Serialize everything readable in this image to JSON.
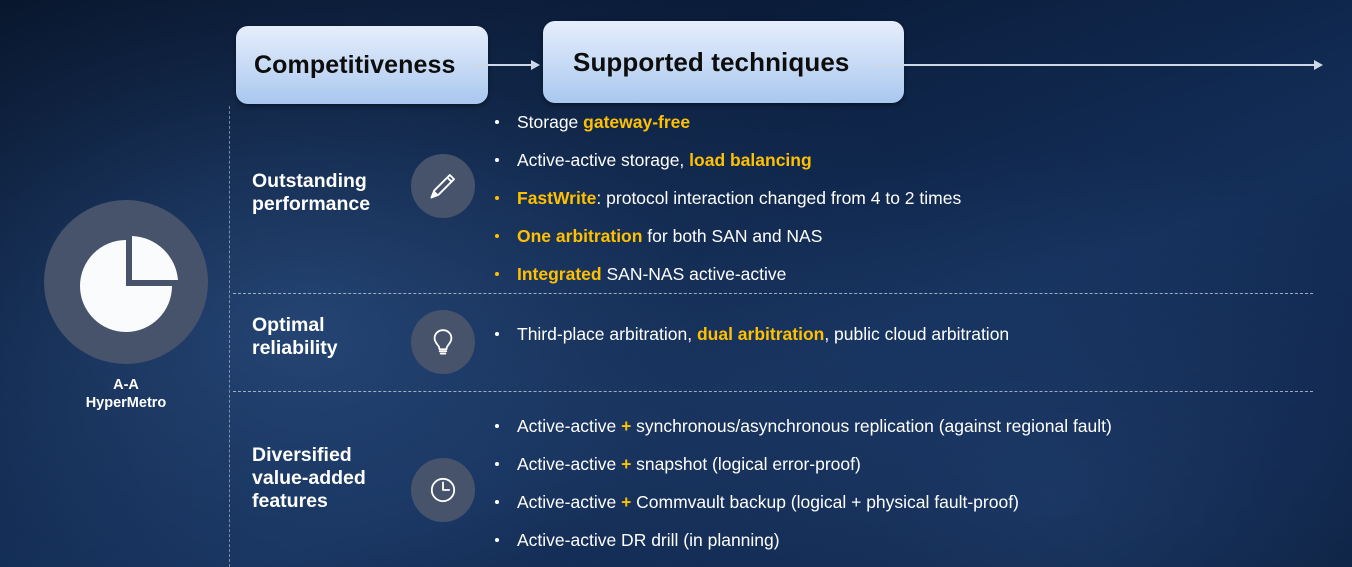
{
  "header": {
    "competitiveness_label": "Competitiveness",
    "supported_label": "Supported techniques"
  },
  "badge": {
    "icon": "pie-chart-icon",
    "line1": "A-A",
    "line2": "HyperMetro"
  },
  "colors": {
    "highlight": "#FFC000",
    "text": "#FFFFFF",
    "icon_circle": "#46536B",
    "header_box_text": "#0D0D0D"
  },
  "rows": [
    {
      "id": "performance",
      "label_line1": "Outstanding",
      "label_line2": "performance",
      "icon": "pencil-icon",
      "bullets": [
        {
          "dot": "white",
          "parts": [
            {
              "t": "Storage ",
              "hl": false
            },
            {
              "t": "gateway-free",
              "hl": true
            }
          ]
        },
        {
          "dot": "white",
          "parts": [
            {
              "t": "Active-active storage, ",
              "hl": false
            },
            {
              "t": "load balancing",
              "hl": true
            }
          ]
        },
        {
          "dot": "accent",
          "parts": [
            {
              "t": "FastWrite",
              "hl": true
            },
            {
              "t": ": protocol interaction changed from 4 to 2 times",
              "hl": false
            }
          ]
        },
        {
          "dot": "accent",
          "parts": [
            {
              "t": "One arbitration",
              "hl": true
            },
            {
              "t": " for both SAN and NAS",
              "hl": false
            }
          ]
        },
        {
          "dot": "accent",
          "parts": [
            {
              "t": "Integrated",
              "hl": true
            },
            {
              "t": " SAN-NAS active-active",
              "hl": false
            }
          ]
        }
      ]
    },
    {
      "id": "reliability",
      "label_line1": "Optimal",
      "label_line2": "reliability",
      "icon": "lightbulb-icon",
      "bullets": [
        {
          "dot": "white",
          "parts": [
            {
              "t": "Third-place arbitration, ",
              "hl": false
            },
            {
              "t": "dual arbitration",
              "hl": true
            },
            {
              "t": ", public cloud arbitration",
              "hl": false
            }
          ]
        }
      ]
    },
    {
      "id": "diversified",
      "label_line1": "Diversified",
      "label_line2": "value-added",
      "label_line3": "features",
      "icon": "clock-icon",
      "bullets": [
        {
          "dot": "white",
          "parts": [
            {
              "t": "Active-active ",
              "hl": false
            },
            {
              "t": "+",
              "hl": true
            },
            {
              "t": " synchronous/asynchronous replication (against regional fault)",
              "hl": false
            }
          ]
        },
        {
          "dot": "white",
          "parts": [
            {
              "t": "Active-active ",
              "hl": false
            },
            {
              "t": "+",
              "hl": true
            },
            {
              "t": " snapshot (logical error-proof)",
              "hl": false
            }
          ]
        },
        {
          "dot": "white",
          "parts": [
            {
              "t": "Active-active ",
              "hl": false
            },
            {
              "t": "+",
              "hl": true
            },
            {
              "t": " Commvault backup (logical + physical fault-proof)",
              "hl": false
            }
          ]
        },
        {
          "dot": "white",
          "parts": [
            {
              "t": "Active-active DR drill (in planning)",
              "hl": false
            }
          ]
        }
      ]
    }
  ]
}
